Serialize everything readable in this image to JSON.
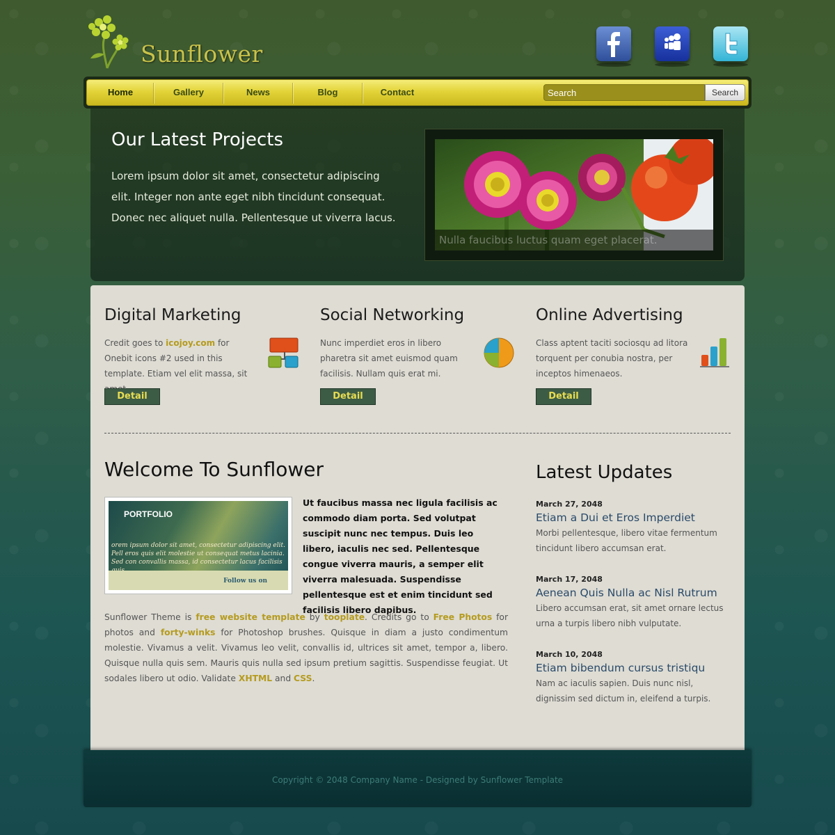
{
  "header": {
    "site_title": "Sunflower",
    "social": [
      {
        "name": "facebook",
        "icon": "facebook-icon",
        "color": "#3b5bab"
      },
      {
        "name": "myspace",
        "icon": "myspace-icon",
        "color": "#1f3db0"
      },
      {
        "name": "twitter",
        "icon": "twitter-icon",
        "color": "#4cc4e3"
      }
    ]
  },
  "nav": {
    "items": [
      {
        "label": "Home",
        "active": true
      },
      {
        "label": "Gallery"
      },
      {
        "label": "News"
      },
      {
        "label": "Blog"
      },
      {
        "label": "Contact"
      }
    ],
    "search_placeholder": "Search",
    "search_button": "Search"
  },
  "hero": {
    "title": "Our Latest Projects",
    "text": "Lorem ipsum dolor sit amet, consectetur adipiscing elit. Integer non ante eget nibh tincidunt consequat. Donec nec aliquet nulla. Pellentesque ut viverra lacus.",
    "caption": "Nulla faucibus luctus quam eget placerat."
  },
  "services": [
    {
      "title": "Digital Marketing",
      "text_before": "Credit goes to ",
      "link": "icojoy.com",
      "text_after": " for Onebit icons #2 used in this template. Etiam vel elit massa, sit amet.",
      "detail": "Detail",
      "icon": "sitemap-icon"
    },
    {
      "title": "Social Networking",
      "text": "Nunc imperdiet eros in libero pharetra sit amet euismod quam facilisis. Nullam quis erat mi.",
      "detail": "Detail",
      "icon": "pie-chart-icon"
    },
    {
      "title": "Online Advertising",
      "text": "Class aptent taciti sociosqu ad litora torquent per conubia nostra, per inceptos himenaeos.",
      "detail": "Detail",
      "icon": "bar-chart-icon"
    }
  ],
  "welcome": {
    "title": "Welcome To Sunflower",
    "portfolio_title": "PORTFOLIO",
    "portfolio_lorem": "orem ipsum dolor sit amet, consectetur adipiscing elit. Pell eros quis elit molestie ut consequat metus lacinia. Sed con convallis massa, id consectetur lacus facilisis quis.",
    "portfolio_follow": "Follow us on",
    "bold_text": "Ut faucibus massa nec ligula facilisis ac commodo diam porta. Sed volutpat suscipit nunc nec tempus. Duis leo libero, iaculis nec sed. Pellentesque congue viverra mauris, a semper elit viverra malesuada. Suspendisse pellentesque est et enim tincidunt sed facilisis libero dapibus.",
    "para": {
      "t1": "Sunflower Theme is ",
      "l1": "free website template",
      "t2": " by ",
      "l2": "tooplate",
      "t3": ". Credits go to ",
      "l3": "Free Photos",
      "t4": " for photos and ",
      "l4": "forty-winks",
      "t5": " for Photoshop brushes. Quisque in diam a justo condimentum molestie. Vivamus a velit. Vivamus leo velit, convallis id, ultrices sit amet, tempor a, libero. Quisque nulla quis sem. Mauris quis nulla sed ipsum pretium sagittis. Suspendisse feugiat. Ut sodales libero ut odio. Validate ",
      "l5": "XHTML",
      "t6": " and ",
      "l6": "CSS",
      "t7": "."
    }
  },
  "updates": {
    "title": "Latest Updates",
    "items": [
      {
        "date": "March 27, 2048",
        "headline": "Etiam a Dui et Eros Imperdiet",
        "summary": "Morbi pellentesque, libero vitae fermentum tincidunt libero accumsan erat."
      },
      {
        "date": "March 17, 2048",
        "headline": "Aenean Quis Nulla ac Nisl Rutrum",
        "summary": "Libero accumsan erat, sit amet ornare lectus urna a turpis libero nibh vulputate."
      },
      {
        "date": "March 10, 2048",
        "headline": "Etiam bibendum cursus tristiqu",
        "summary": "Nam ac iaculis sapien. Duis nunc nisl, dignissim sed dictum in, eleifend a turpis."
      }
    ]
  },
  "footer": {
    "text": "Copyright © 2048 Company Name - Designed by Sunflower Template"
  }
}
